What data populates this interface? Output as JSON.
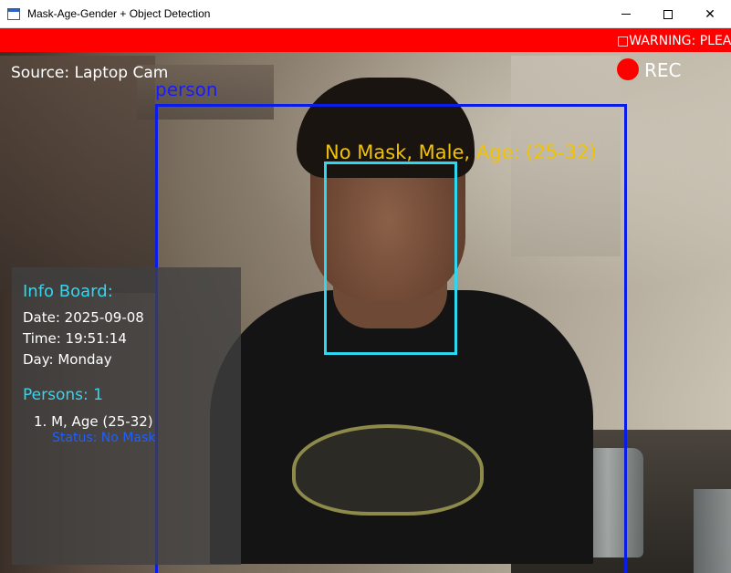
{
  "window": {
    "title": "Mask-Age-Gender + Object Detection",
    "icon": "app-window-icon",
    "controls": [
      "minimize",
      "maximize",
      "close"
    ]
  },
  "banner": {
    "text": "□WARNING: PLEAS",
    "color": "#ff0000"
  },
  "overlay": {
    "source": "Source: Laptop Cam",
    "rec": "REC"
  },
  "detections": {
    "person_label": "person",
    "face_label": "No Mask, Male, Age: (25-32)",
    "colors": {
      "person_box": "#0a1de8",
      "face_box": "#2fd6f0",
      "face_label": "#f2c200"
    }
  },
  "info_board": {
    "title": "Info Board:",
    "date": "Date: 2025-09-08",
    "time": "Time: 19:51:14",
    "day": "Day:  Monday",
    "persons": "Persons: 1",
    "entries": [
      {
        "label": "1. M, Age (25-32)",
        "status": "Status: No Mask"
      }
    ]
  }
}
